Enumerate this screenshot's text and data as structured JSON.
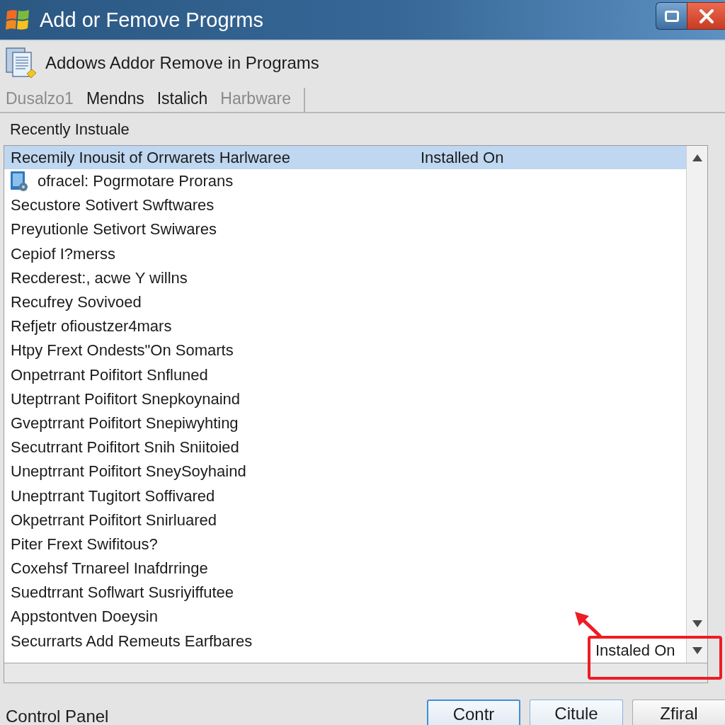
{
  "window": {
    "title": "Add or Femove Progrms"
  },
  "header": {
    "title": "Addows Addor Remove in Programs"
  },
  "tabs": [
    {
      "label": "Dusalzo1",
      "disabled": true
    },
    {
      "label": "Mendns",
      "disabled": false
    },
    {
      "label": "Istalich",
      "disabled": false
    },
    {
      "label": "Harbware",
      "disabled": true
    }
  ],
  "section": {
    "label": "Recently Instuale"
  },
  "list": {
    "columns": [
      "Recemily Inousit of Orrwarets Harlwaree",
      "Installed On"
    ],
    "rows": [
      {
        "name": "ofracel: Pogrmotare Prorans",
        "kind": "program"
      },
      {
        "name": "Secustore Sotivert Swftwares",
        "kind": "text"
      },
      {
        "name": "Preyutionle Setivort Swiwares",
        "kind": "text"
      },
      {
        "name": "Cepiof I?merss",
        "kind": "text"
      },
      {
        "name": "Recderest:, acwe Y willns",
        "kind": "text"
      },
      {
        "name": "Recufrey Sovivoed",
        "kind": "text"
      },
      {
        "name": "Refjetr ofioustzer4mars",
        "kind": "text"
      },
      {
        "name": "Htpy Frext Ondests\"On Somarts",
        "kind": "text"
      },
      {
        "name": "Onpetrrant Poifitort Snfluned",
        "kind": "text"
      },
      {
        "name": "Uteptrrant Poifitort Snepkoynaind",
        "kind": "text"
      },
      {
        "name": "Gveptrrant Poifitort Snepiwyhting",
        "kind": "text"
      },
      {
        "name": "Secutrrant Poifitort Snih Sniitoied",
        "kind": "text"
      },
      {
        "name": "Uneptrrant Poifitort SneySoyhaind",
        "kind": "text"
      },
      {
        "name": "Uneptrrant Tugitort Soffivared",
        "kind": "text"
      },
      {
        "name": "Okpetrrant Poifitort Snirluared",
        "kind": "text"
      },
      {
        "name": "Piter Frext Swifitous?",
        "kind": "text"
      },
      {
        "name": "Coxehsf Trnareel Inafdrringe",
        "kind": "text"
      },
      {
        "name": "Suedtrrant Soflwart Susriyiffutee",
        "kind": "text"
      },
      {
        "name": "Appstontven Doeysin",
        "kind": "text"
      },
      {
        "name": "Securrarts Add Remeuts Earfbares",
        "kind": "text"
      }
    ],
    "sort_field": {
      "value": "Instaled On"
    }
  },
  "status_bar": {
    "text": "Control Panel"
  },
  "buttons": [
    {
      "label": "Contr",
      "kind": "default"
    },
    {
      "label": "Citule",
      "kind": "hover"
    },
    {
      "label": "Zfiral",
      "kind": "normal"
    }
  ]
}
